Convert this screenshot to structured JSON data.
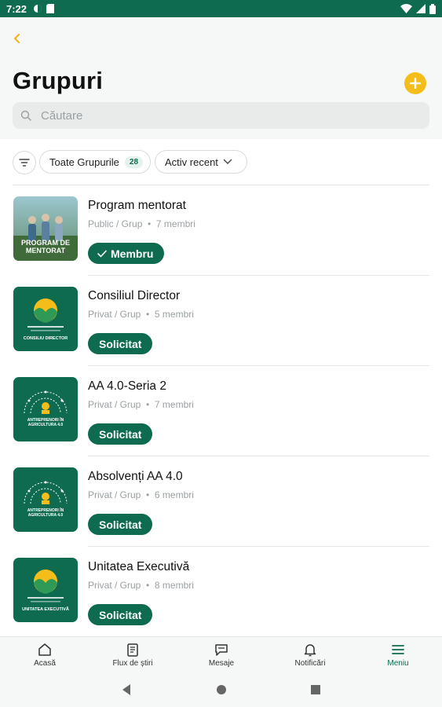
{
  "status_bar": {
    "time": "7:22"
  },
  "header": {
    "title": "Grupuri"
  },
  "search": {
    "placeholder": "Căutare"
  },
  "filters": {
    "all_groups_label": "Toate Grupurile",
    "all_groups_count": "28",
    "sort_label": "Activ recent"
  },
  "groups": [
    {
      "name": "Program mentorat",
      "privacy": "Public / Grup",
      "members": "7 membri",
      "status": "Membru",
      "thumb_text": "PROGRAM DE MENTORAT"
    },
    {
      "name": "Consiliul Director",
      "privacy": "Privat / Grup",
      "members": "5 membri",
      "status": "Solicitat",
      "thumb_text": "CONSILIU DIRECTOR"
    },
    {
      "name": "AA 4.0-Seria 2",
      "privacy": "Privat / Grup",
      "members": "7 membri",
      "status": "Solicitat",
      "thumb_text": "ANTREPRENORI ÎN AGRICULTURA 4.0"
    },
    {
      "name": "Absolvenți AA 4.0",
      "privacy": "Privat / Grup",
      "members": "6 membri",
      "status": "Solicitat",
      "thumb_text": "ANTREPRENORI ÎN AGRICULTURA 4.0"
    },
    {
      "name": "Unitatea Executivă",
      "privacy": "Privat / Grup",
      "members": "8 membri",
      "status": "Solicitat",
      "thumb_text": "UNITATEA EXECUTIVĂ"
    }
  ],
  "nav": {
    "home": "Acasă",
    "feed": "Flux de știri",
    "messages": "Mesaje",
    "notifications": "Notificări",
    "menu": "Meniu"
  },
  "colors": {
    "brand_green": "#0e6b4f",
    "accent_yellow": "#f4bd1a"
  },
  "icons": [
    "back-icon",
    "add-icon",
    "search-icon",
    "filter-icon",
    "chevron-down-icon",
    "check-icon",
    "home-icon",
    "feed-icon",
    "messages-icon",
    "bell-icon",
    "menu-icon"
  ]
}
